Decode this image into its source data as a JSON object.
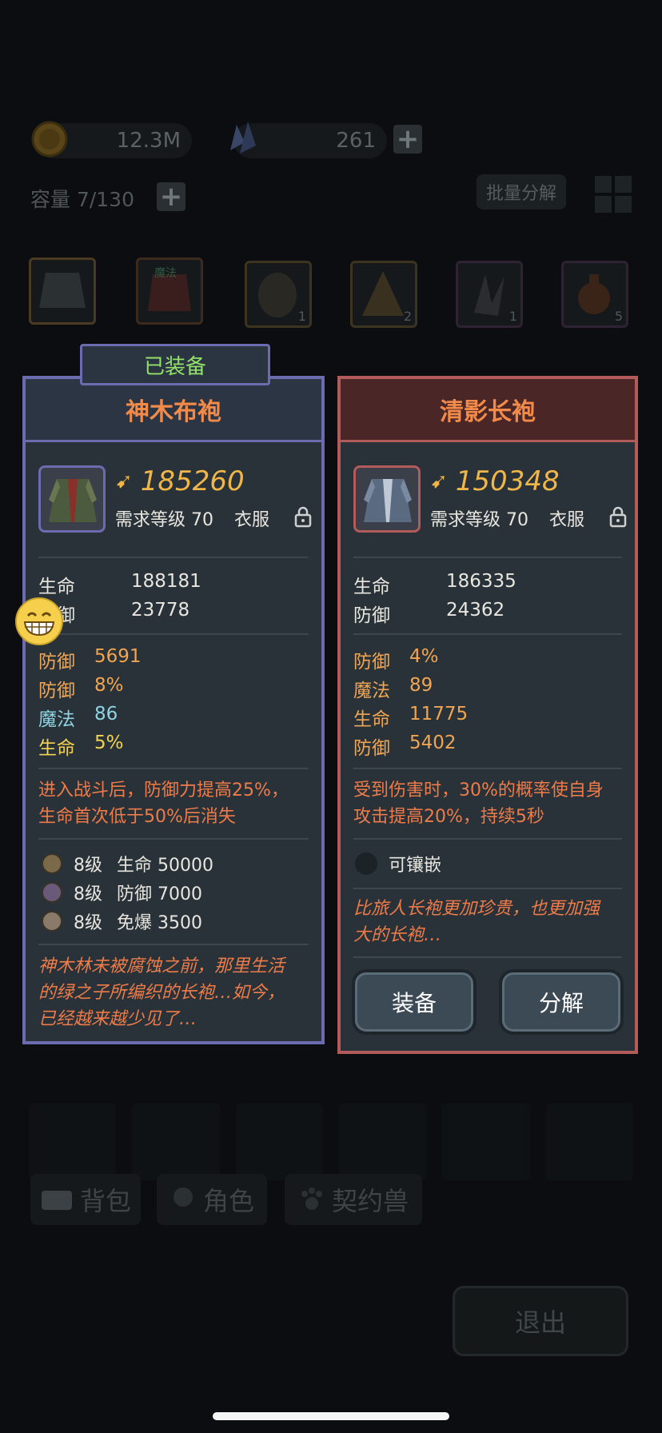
{
  "top_bar": {
    "coins": "12.3M",
    "gems": "261",
    "capacity": "容量 7/130",
    "batch_decompose": "批量分解"
  },
  "inventory": {
    "slots": [
      {
        "name": "robe",
        "count": ""
      },
      {
        "name": "magic-robe",
        "label": "魔法",
        "count": ""
      },
      {
        "name": "stone-armor",
        "count": "1"
      },
      {
        "name": "cone-armor",
        "count": "2"
      },
      {
        "name": "claw",
        "count": "1"
      },
      {
        "name": "potion",
        "count": "5"
      }
    ]
  },
  "bottom_tabs": [
    "背包",
    "角色",
    "契约兽"
  ],
  "exit": "退出",
  "equipped_tag": "已装备",
  "left_item": {
    "name": "神木布袍",
    "power": "185260",
    "req_level": "需求等级 70",
    "type": "衣服",
    "base_stats": [
      {
        "k": "生命",
        "v": "188181"
      },
      {
        "k": "防御",
        "v": "23778"
      }
    ],
    "extra_stats": [
      {
        "k": "防御",
        "v": "5691",
        "color": "orange"
      },
      {
        "k": "防御",
        "v": "8%",
        "color": "orange"
      },
      {
        "k": "魔法",
        "v": "86",
        "color": "cyan"
      },
      {
        "k": "生命",
        "v": "5%",
        "color": "yellow"
      }
    ],
    "effect": [
      "进入战斗后，防御力提高25%，",
      "生命首次低于50%后消失"
    ],
    "gems": [
      {
        "lvl": "8级",
        "text": "生命 50000"
      },
      {
        "lvl": "8级",
        "text": "防御 7000"
      },
      {
        "lvl": "8级",
        "text": "免爆 3500"
      }
    ],
    "flavor": [
      "神木林未被腐蚀之前，那里生活",
      "的绿之子所编织的长袍…如今，",
      "已经越来越少见了…"
    ]
  },
  "right_item": {
    "name": "清影长袍",
    "power": "150348",
    "req_level": "需求等级 70",
    "type": "衣服",
    "base_stats": [
      {
        "k": "生命",
        "v": "186335"
      },
      {
        "k": "防御",
        "v": "24362"
      }
    ],
    "extra_stats": [
      {
        "k": "防御",
        "v": "4%",
        "color": "orange"
      },
      {
        "k": "魔法",
        "v": "89",
        "color": "orange"
      },
      {
        "k": "生命",
        "v": "11775",
        "color": "orange"
      },
      {
        "k": "防御",
        "v": "5402",
        "color": "orange"
      }
    ],
    "effect": [
      "受到伤害时，30%的概率使自身",
      "攻击提高20%，持续5秒"
    ],
    "socket": "可镶嵌",
    "flavor": [
      "比旅人长袍更加珍贵，也更加强",
      "大的长袍…"
    ],
    "equip_button": "装备",
    "decompose_button": "分解"
  }
}
